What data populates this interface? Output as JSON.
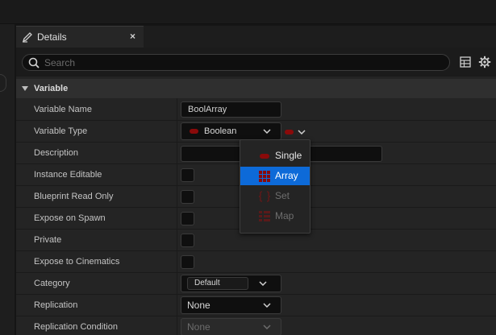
{
  "tab": {
    "title": "Details",
    "close_glyph": "×",
    "icon": "pencil-icon"
  },
  "search": {
    "placeholder": "Search",
    "value": ""
  },
  "section": {
    "title": "Variable"
  },
  "colors": {
    "bool_pin": "#8a0a0a",
    "selection": "#0d6ad8",
    "panel": "#242424"
  },
  "rows": [
    {
      "label": "Variable Name"
    },
    {
      "label": "Variable Type"
    },
    {
      "label": "Description"
    },
    {
      "label": "Instance Editable"
    },
    {
      "label": "Blueprint Read Only"
    },
    {
      "label": "Expose on Spawn"
    },
    {
      "label": "Private"
    },
    {
      "label": "Expose to Cinematics"
    },
    {
      "label": "Category"
    },
    {
      "label": "Replication"
    },
    {
      "label": "Replication Condition"
    }
  ],
  "fields": {
    "variable_name": "BoolArray",
    "variable_type": "Boolean",
    "description": "",
    "category": "Default",
    "replication": "None",
    "replication_condition": "None"
  },
  "container_menu": {
    "items": [
      {
        "label": "Single",
        "icon": "single-pin-icon",
        "state": "normal"
      },
      {
        "label": "Array",
        "icon": "array-grid-icon",
        "state": "selected"
      },
      {
        "label": "Set",
        "icon": "set-braces-icon",
        "state": "disabled"
      },
      {
        "label": "Map",
        "icon": "map-list-icon",
        "state": "disabled"
      }
    ]
  }
}
